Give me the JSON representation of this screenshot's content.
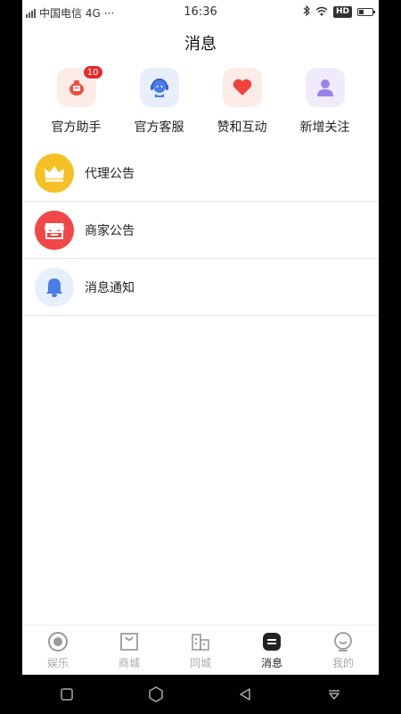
{
  "status_bar": {
    "network": "4G",
    "carrier": "中国电信 4G",
    "more": "···",
    "time": "16:36",
    "hd": "HD"
  },
  "header": {
    "title": "消息"
  },
  "quick_actions": [
    {
      "label": "官方助手",
      "badge": "10",
      "icon": "official-assistant-icon",
      "color": "#f24b3c",
      "bg": "#fdebe7"
    },
    {
      "label": "官方客服",
      "icon": "customer-service-icon",
      "color": "#4a7de8",
      "bg": "#e8effc"
    },
    {
      "label": "赞和互动",
      "icon": "heart-icon",
      "color": "#f0433e",
      "bg": "#fdebe7"
    },
    {
      "label": "新增关注",
      "icon": "user-icon",
      "color": "#9b82e6",
      "bg": "#efebfa"
    }
  ],
  "list": [
    {
      "label": "代理公告",
      "icon": "crown-icon",
      "color": "#f5c025"
    },
    {
      "label": "商家公告",
      "icon": "store-icon",
      "color": "#f04848"
    },
    {
      "label": "消息通知",
      "icon": "bell-icon",
      "color": "#4a7de8"
    }
  ],
  "tabs": [
    {
      "label": "娱乐",
      "icon": "entertainment-icon",
      "active": false
    },
    {
      "label": "商城",
      "icon": "shopping-bag-icon",
      "active": false
    },
    {
      "label": "同城",
      "icon": "buildings-icon",
      "active": false
    },
    {
      "label": "消息",
      "icon": "message-icon",
      "active": true
    },
    {
      "label": "我的",
      "icon": "profile-icon",
      "active": false
    }
  ],
  "nav": [
    "square-icon",
    "hexagon-icon",
    "back-triangle-icon",
    "download-icon"
  ]
}
